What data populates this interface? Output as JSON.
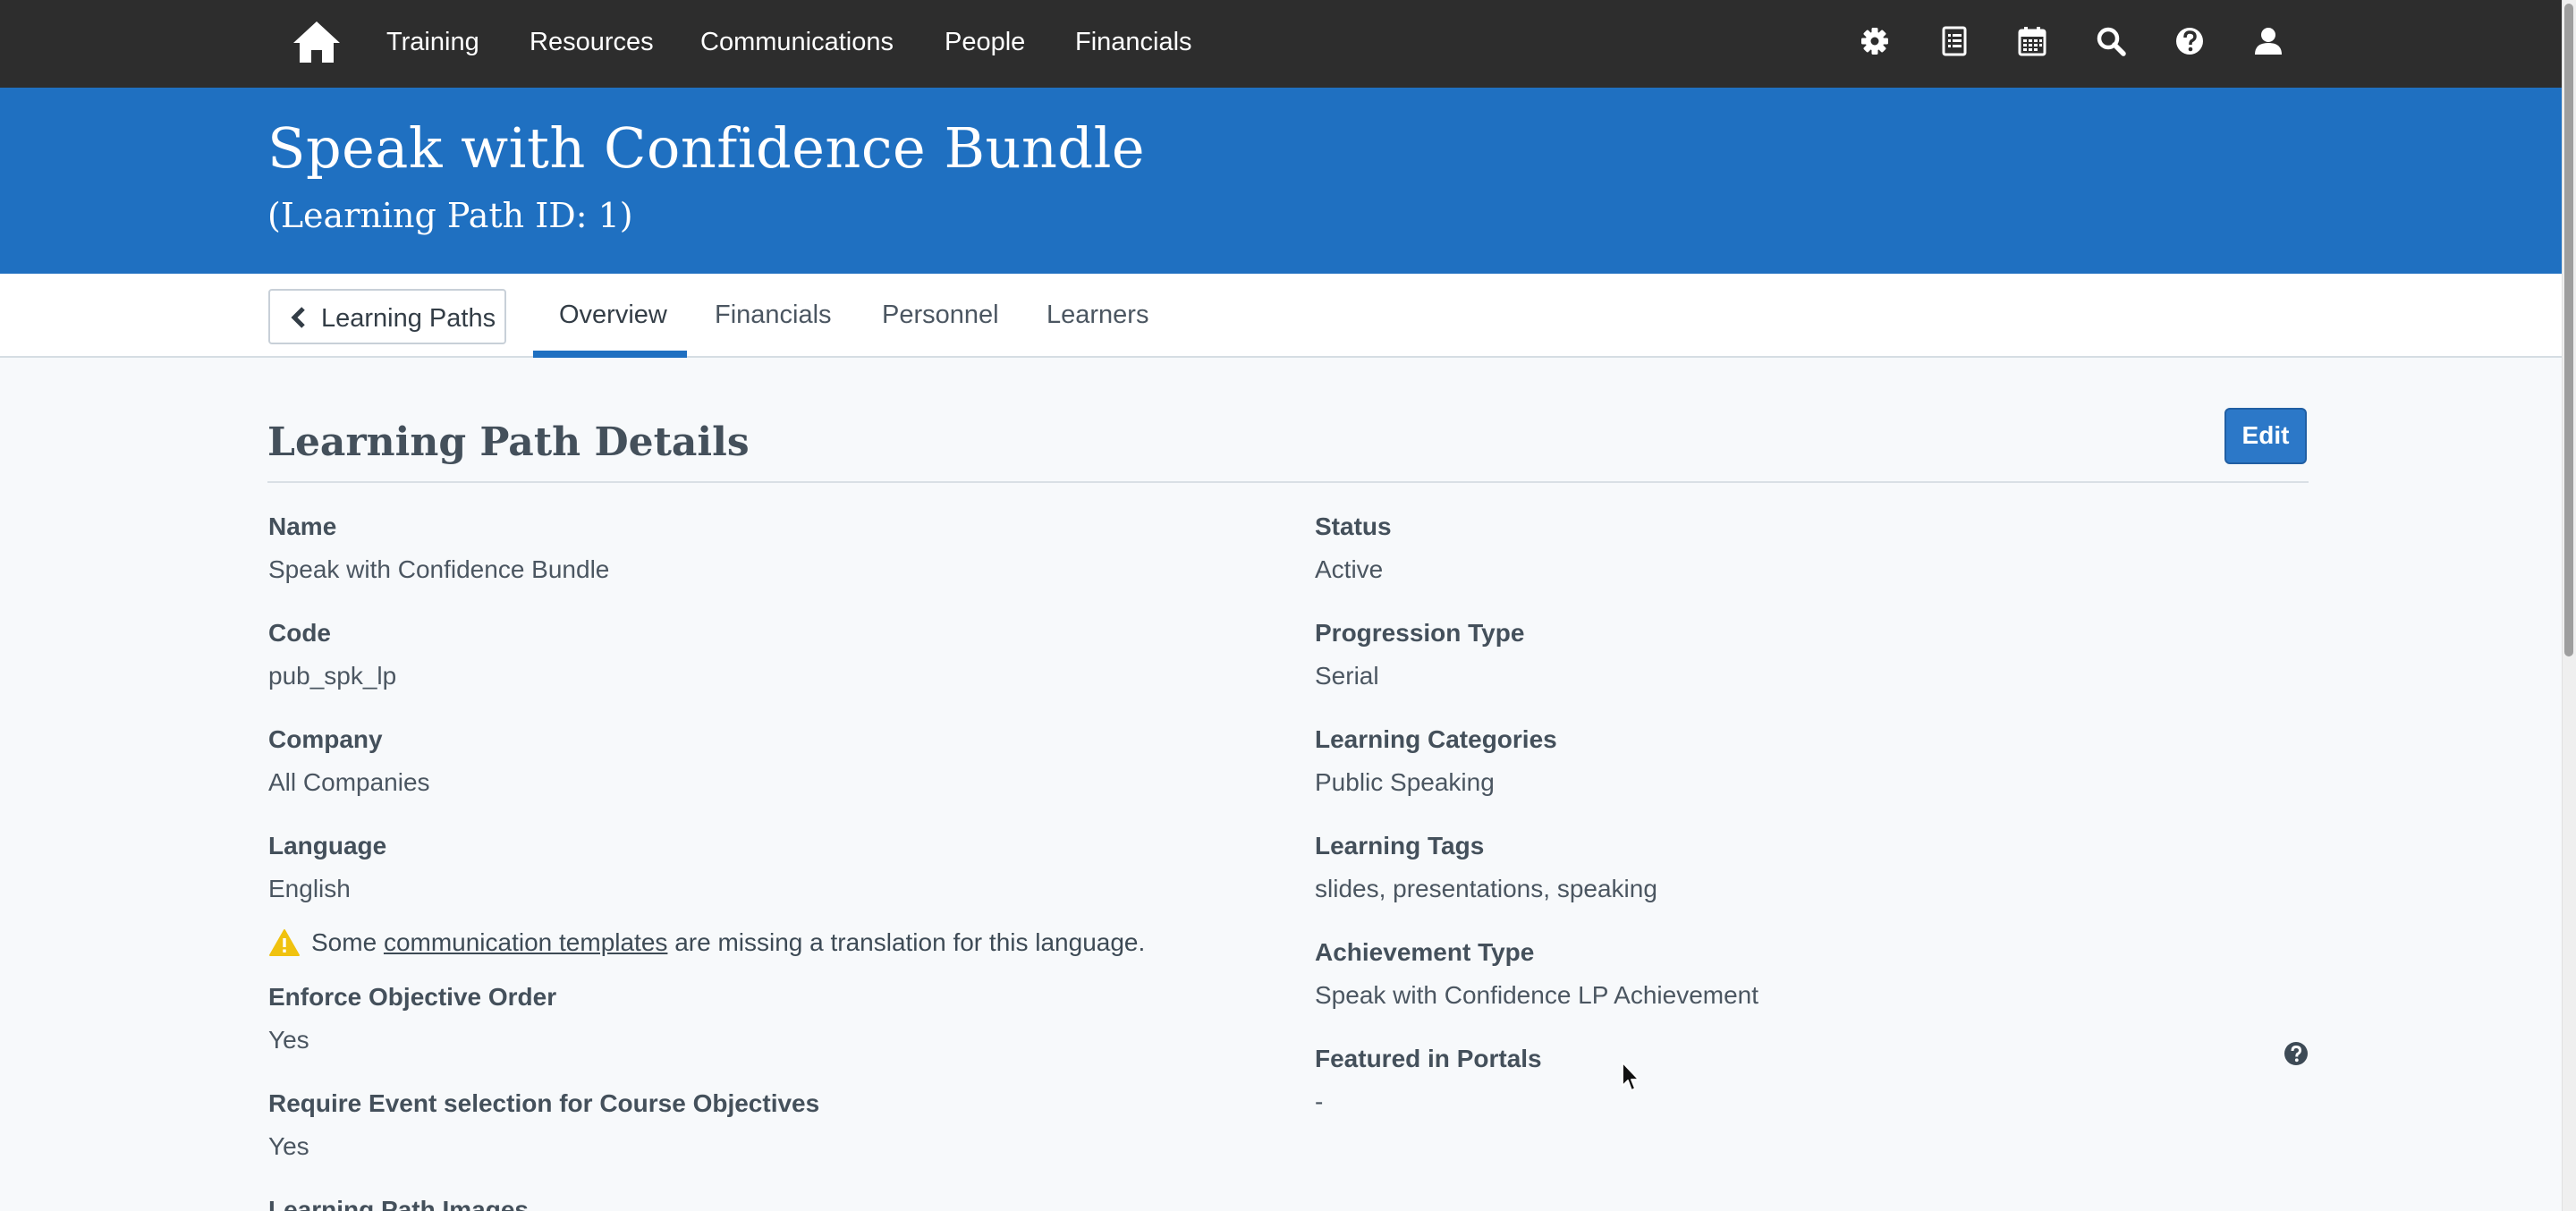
{
  "nav": {
    "links": [
      "Training",
      "Resources",
      "Communications",
      "People",
      "Financials"
    ],
    "icons": [
      "gear-icon",
      "report-icon",
      "calendar-icon",
      "search-icon",
      "help-icon",
      "user-icon"
    ]
  },
  "header": {
    "title": "Speak with Confidence Bundle",
    "subtitle": "(Learning Path ID: 1)"
  },
  "tabs": {
    "back_label": "Learning Paths",
    "items": [
      "Overview",
      "Financials",
      "Personnel",
      "Learners"
    ],
    "active": "Overview"
  },
  "details": {
    "section_title": "Learning Path Details",
    "edit_label": "Edit",
    "left": [
      {
        "label": "Name",
        "value": "Speak with Confidence Bundle"
      },
      {
        "label": "Code",
        "value": "pub_spk_lp"
      },
      {
        "label": "Company",
        "value": "All Companies"
      },
      {
        "label": "Language",
        "value": "English"
      },
      {
        "label": "Enforce Objective Order",
        "value": "Yes"
      },
      {
        "label": "Require Event selection for Course Objectives",
        "value": "Yes"
      },
      {
        "label": "Learning Path Images",
        "value": ""
      }
    ],
    "right": [
      {
        "label": "Status",
        "value": "Active"
      },
      {
        "label": "Progression Type",
        "value": "Serial"
      },
      {
        "label": "Learning Categories",
        "value": "Public Speaking"
      },
      {
        "label": "Learning Tags",
        "value": "slides, presentations, speaking"
      },
      {
        "label": "Achievement Type",
        "value": "Speak with Confidence LP Achievement"
      },
      {
        "label": "Featured in Portals",
        "value": "-"
      }
    ],
    "warning": {
      "prefix": "Some ",
      "link": "communication templates",
      "suffix": " are missing a translation for this language."
    }
  },
  "colors": {
    "nav_bg": "#2d2d2d",
    "banner_bg": "#1f70c1",
    "accent": "#1f70c1",
    "edit_button": "#2c78c8",
    "warning": "#f0c20f"
  }
}
